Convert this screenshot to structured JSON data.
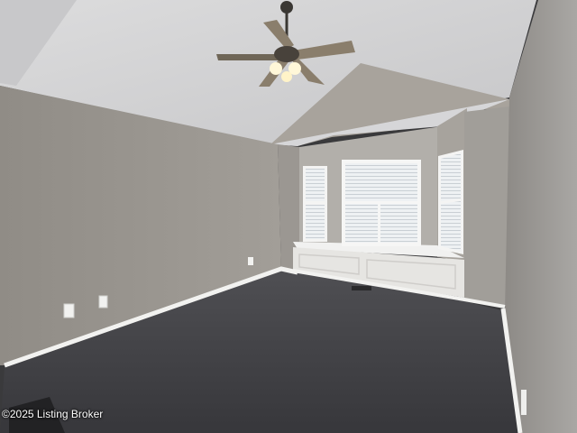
{
  "photo": {
    "watermark": "©2025 Listing Broker"
  }
}
